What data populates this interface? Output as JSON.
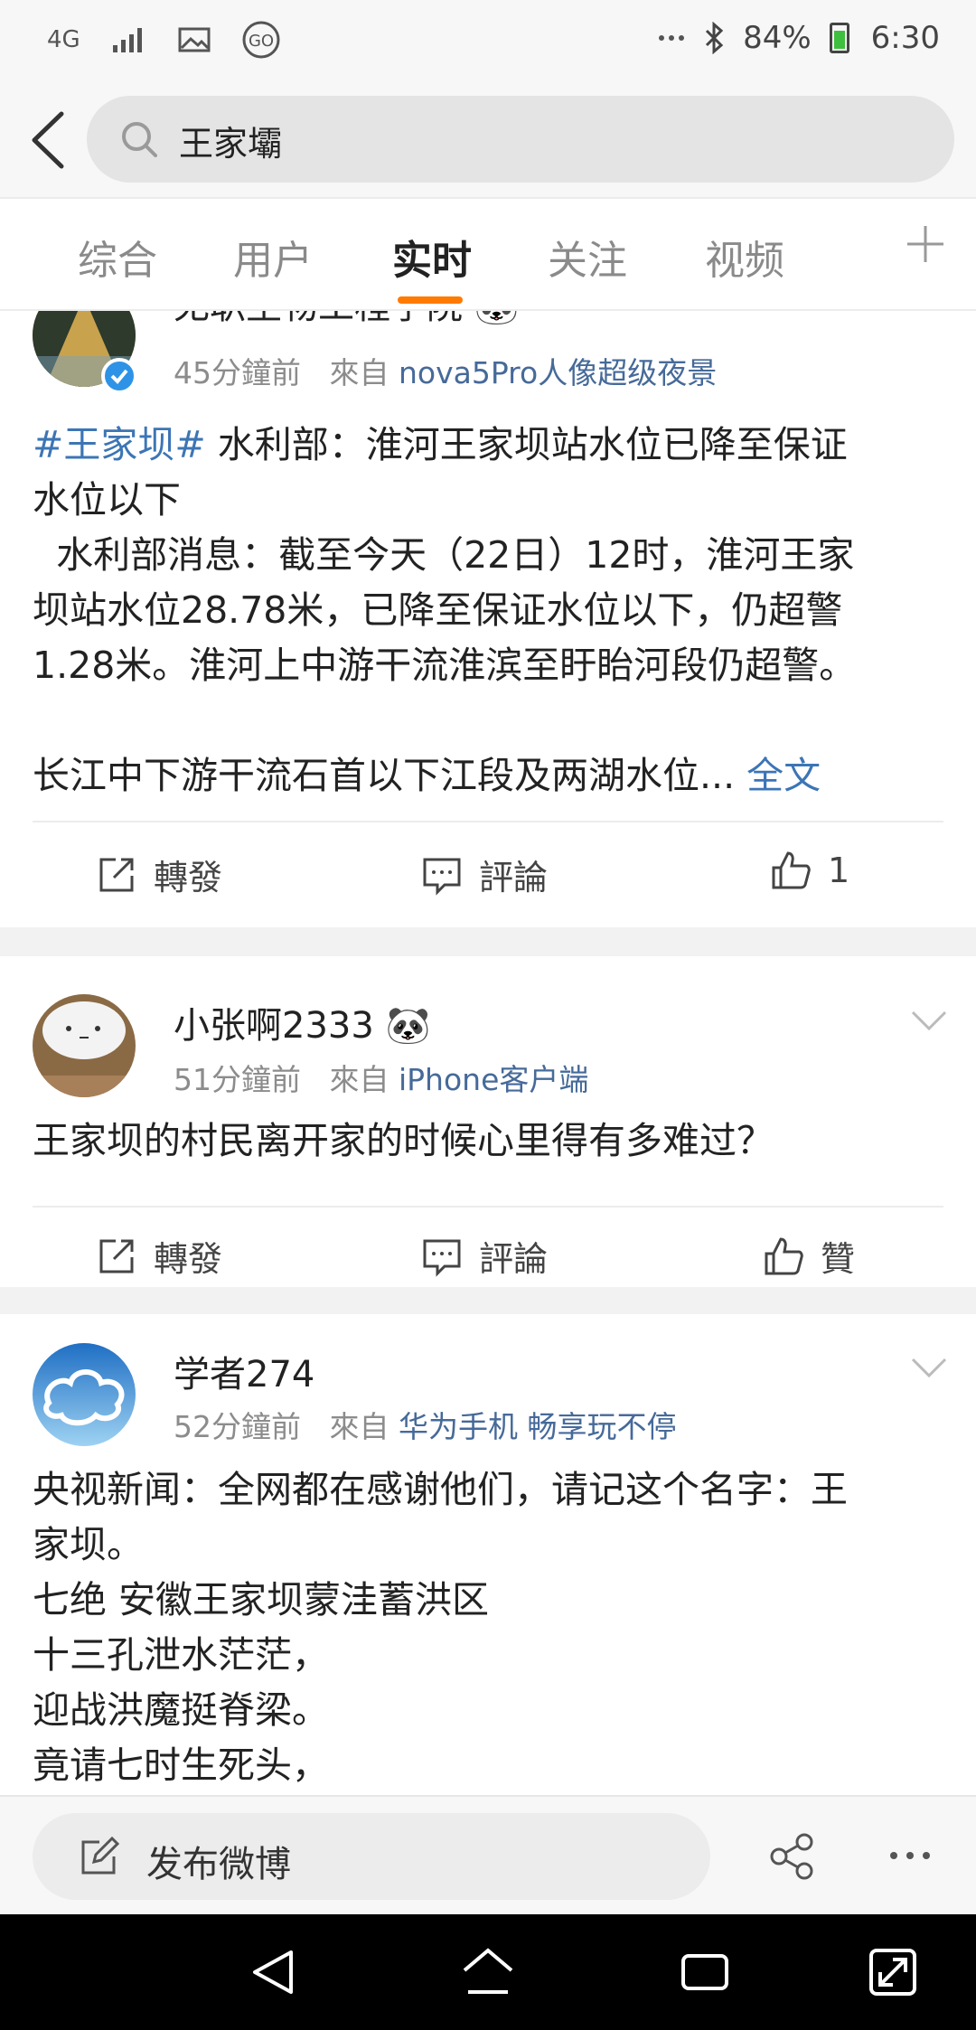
{
  "status_bar": {
    "network": "4G",
    "battery": "84%",
    "time": "6:30",
    "icons": [
      "signal-icon",
      "gallery-icon",
      "go-icon",
      "more-dots-icon",
      "bluetooth-icon",
      "battery-icon"
    ]
  },
  "search": {
    "query": "王家壩"
  },
  "tabs": [
    {
      "label": "综合",
      "active": false
    },
    {
      "label": "用户",
      "active": false
    },
    {
      "label": "实时",
      "active": true
    },
    {
      "label": "关注",
      "active": false
    },
    {
      "label": "视频",
      "active": false
    }
  ],
  "actions": {
    "repost": "轉發",
    "comment": "評論",
    "like_label": "贊"
  },
  "posts": [
    {
      "author": "无职生物工程学院",
      "author_badge": "🐼",
      "time": "45分鐘前",
      "from_label": "來自",
      "source": "nova5Pro人像超级夜景",
      "verified": true,
      "tag": "#王家坝#",
      "lines": [
        "水利部：淮河王家坝站水位已降至保证",
        "水位以下",
        "  水利部消息：截至今天（22日）12时，淮河王家",
        "坝站水位28.78米，已降至保证水位以下，仍超警",
        "1.28米。淮河上中游干流淮滨至盱眙河段仍超警。",
        "",
        "长江中下游干流石首以下江段及两湖水位..."
      ],
      "more": "全文",
      "like": "1"
    },
    {
      "author": "小张啊2333",
      "author_badge": "🐼",
      "time": "51分鐘前",
      "from_label": "來自",
      "source": "iPhone客户端",
      "text": "王家坝的村民离开家的时候心里得有多难过？",
      "like": "贊"
    },
    {
      "author": "学者274",
      "time": "52分鐘前",
      "from_label": "來自",
      "source": "华为手机 畅享玩不停",
      "lines": [
        "央视新闻：全网都在感谢他们，请记这个名字：王",
        "家坝。",
        "七绝 安徽王家坝蒙洼蓄洪区",
        "十三孔泄水茫茫，",
        "迎战洪魔挺脊梁。",
        "竟请七时生死头，"
      ]
    }
  ],
  "compose": {
    "label": "发布微博"
  },
  "colors": {
    "accent": "#ff7a00",
    "link": "#3c75b5",
    "source": "#466a99",
    "verified": "#2e93e6"
  }
}
